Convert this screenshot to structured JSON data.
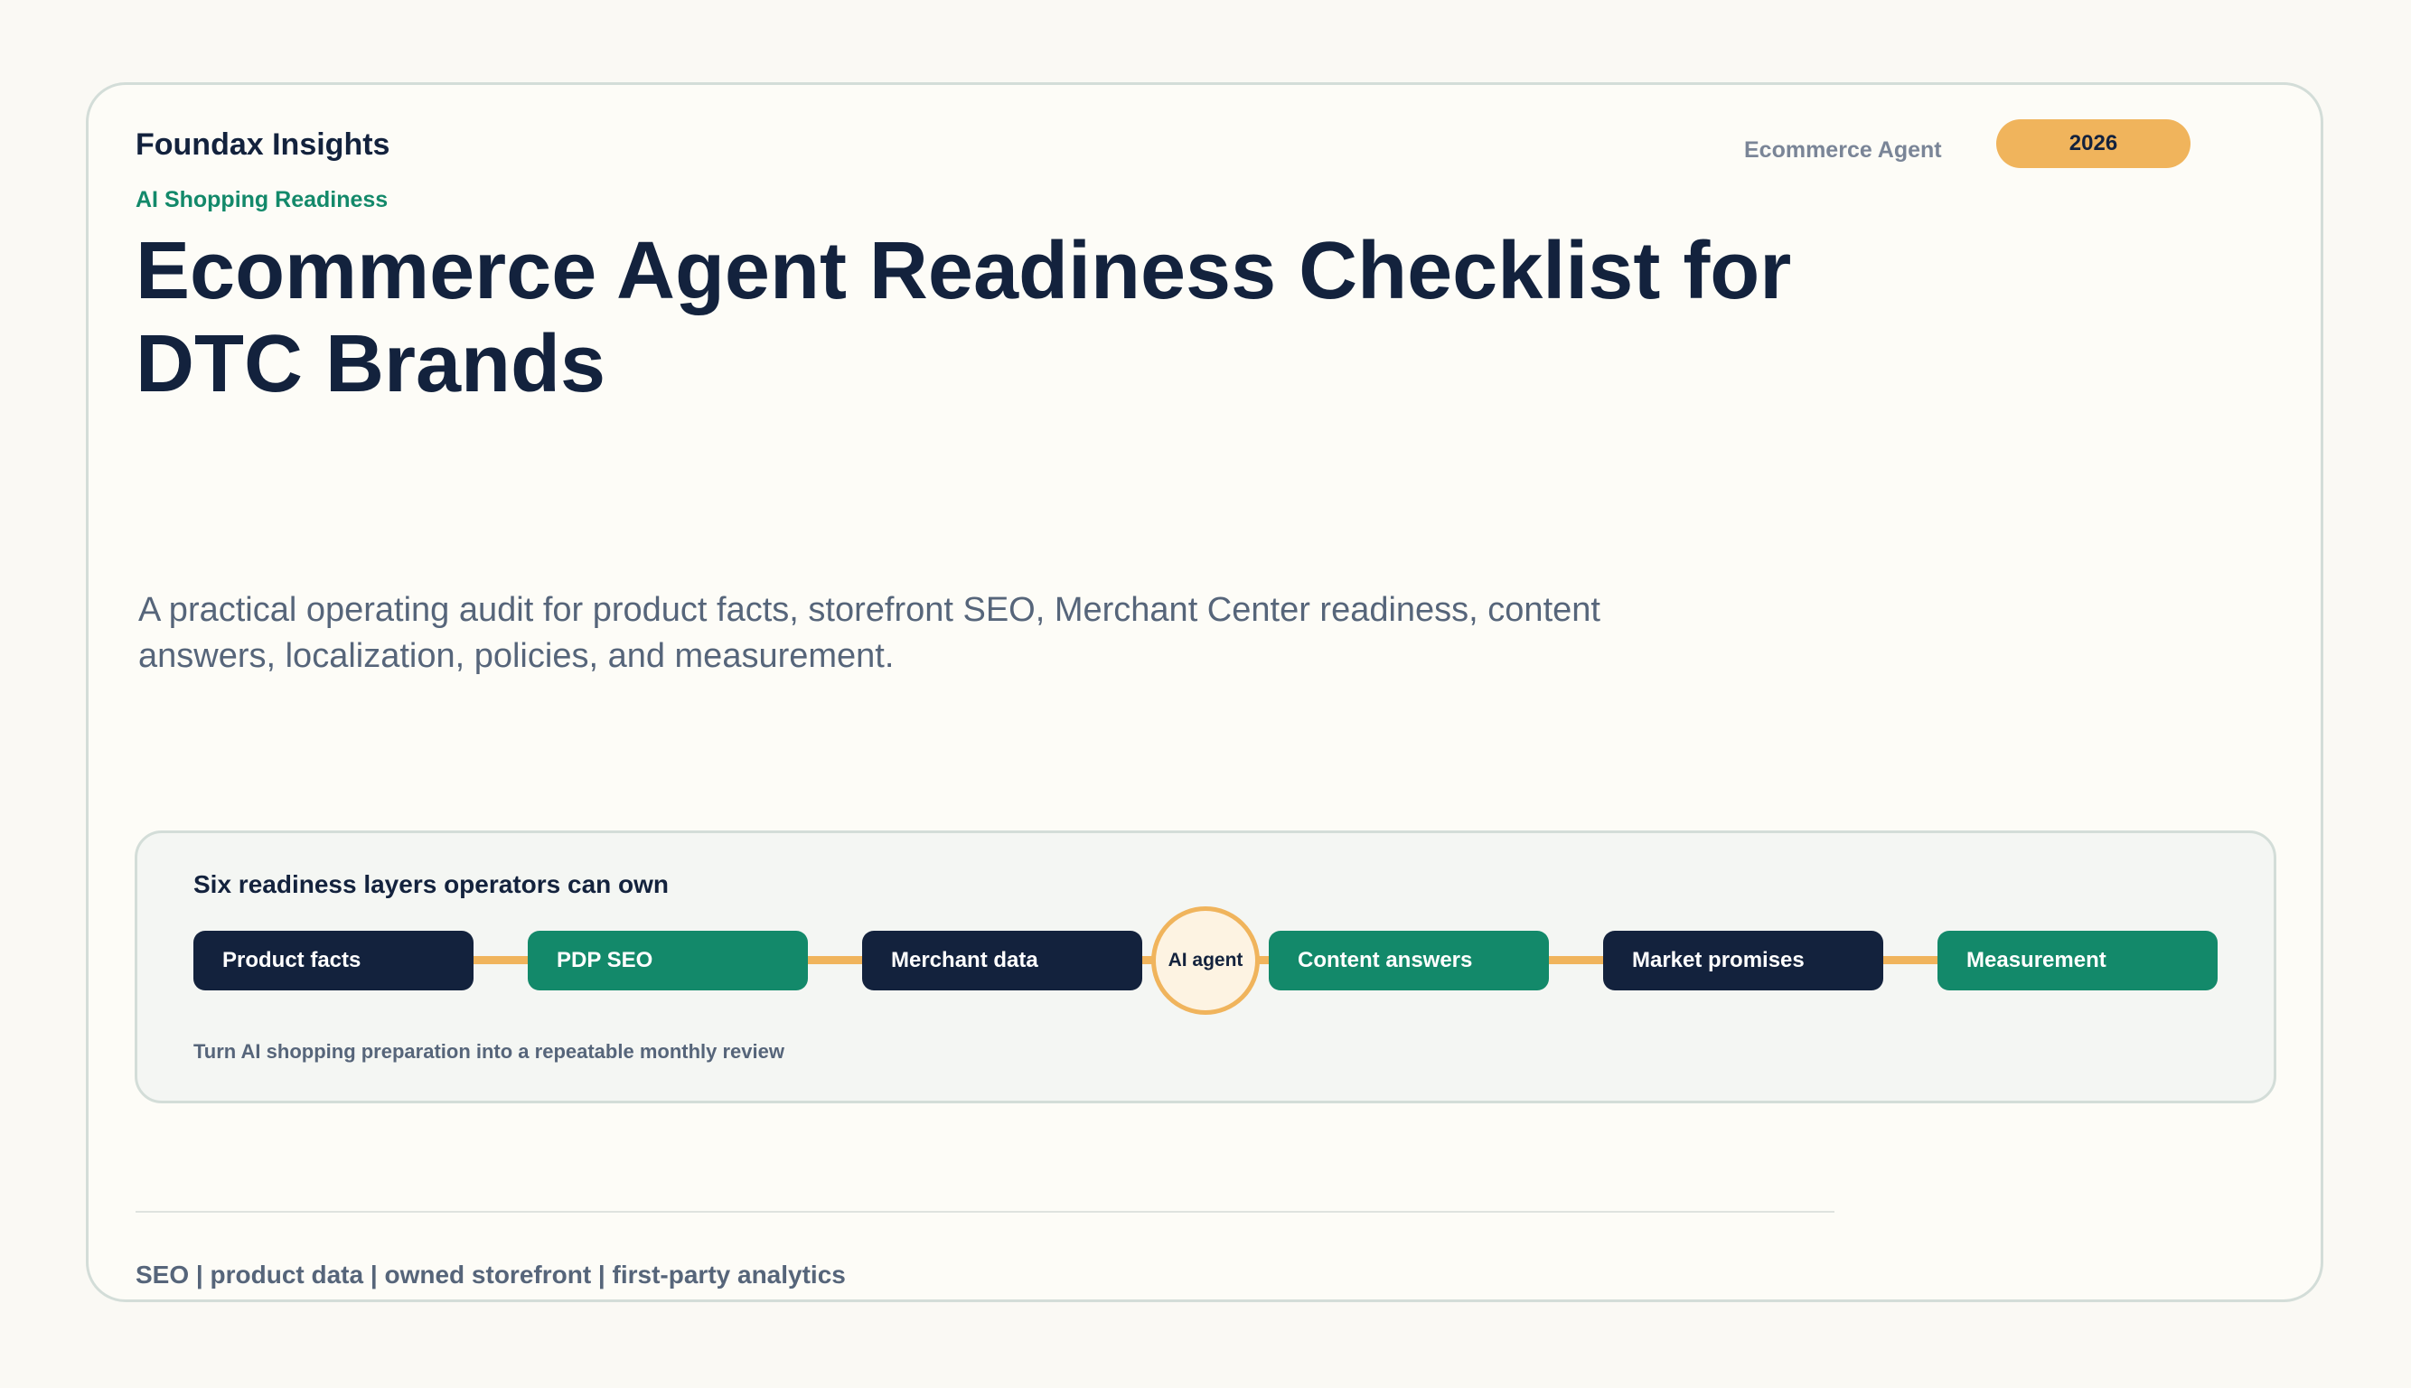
{
  "header": {
    "brand": "Foundax Insights",
    "eyebrow": "AI Shopping Readiness",
    "category": "Ecommerce Agent",
    "year": "2026"
  },
  "hero": {
    "title": "Ecommerce Agent Readiness Checklist for DTC Brands",
    "subtitle": "A practical operating audit for product facts, storefront SEO, Merchant Center readiness, content answers, localization, policies, and measurement."
  },
  "diagram": {
    "title": "Six readiness layers operators can own",
    "layers": [
      {
        "label": "Product facts"
      },
      {
        "label": "PDP SEO"
      },
      {
        "label": "Merchant data"
      },
      {
        "label": "Content answers"
      },
      {
        "label": "Market promises"
      },
      {
        "label": "Measurement"
      }
    ],
    "hub": "AI agent",
    "note": "Turn AI shopping preparation into a repeatable monthly review"
  },
  "footer": {
    "tags": "SEO | product data | owned storefront | first-party analytics"
  },
  "colors": {
    "navy": "#13223d",
    "green": "#13896a",
    "amber": "#f0b45c",
    "slate": "#56657a",
    "background": "#faf9f4"
  }
}
